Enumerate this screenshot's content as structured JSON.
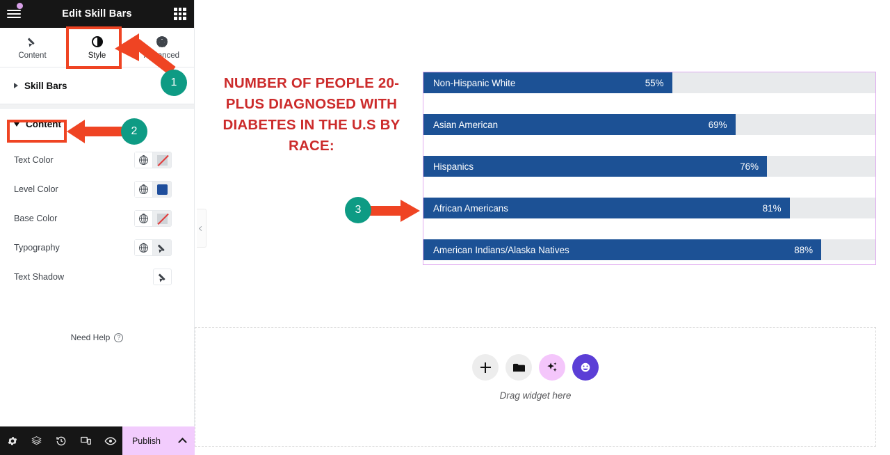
{
  "panel": {
    "title": "Edit Skill Bars",
    "menu_icon": "hamburger-icon",
    "apps_icon": "grid-icon",
    "tabs": [
      {
        "label": "Content",
        "icon": "pencil-icon",
        "active": false
      },
      {
        "label": "Style",
        "icon": "contrast-icon",
        "active": true
      },
      {
        "label": "Advanced",
        "icon": "gear-icon",
        "active": false
      }
    ],
    "sections": [
      {
        "label": "Skill Bars",
        "state": "collapsed"
      },
      {
        "label": "Content",
        "state": "expanded"
      }
    ],
    "controls": [
      {
        "label": "Text Color",
        "globe": "globe-icon",
        "value_type": "none",
        "value": ""
      },
      {
        "label": "Level Color",
        "globe": "globe-icon",
        "value_type": "color",
        "value": "#1f4e9c"
      },
      {
        "label": "Base Color",
        "globe": "globe-icon",
        "value_type": "none",
        "value": ""
      },
      {
        "label": "Typography",
        "globe": "globe-icon",
        "value_type": "edit",
        "value": ""
      },
      {
        "label": "Text Shadow",
        "globe": "",
        "value_type": "edit",
        "value": ""
      }
    ],
    "need_help": "Need Help",
    "bottom_icons": [
      "settings-icon",
      "layers-icon",
      "history-icon",
      "responsive-icon",
      "preview-icon"
    ],
    "publish_label": "Publish",
    "publish_caret": "chevron-up-icon"
  },
  "canvas": {
    "chart_title": "NUMBER OF PEOPLE 20-PLUS DIAGNOSED WITH DIABETES IN THE U.S BY RACE:",
    "collapse_icon": "chevron-left-icon",
    "drop_label": "Drag widget here",
    "drop_buttons": [
      "add-icon",
      "folder-icon",
      "ai-sparkle-icon",
      "elementor-icon"
    ]
  },
  "annotations": {
    "markers": [
      "1",
      "2",
      "3"
    ],
    "accent_circle": "#0e9b84",
    "accent_arrow": "#ef4423",
    "highlight_box": "#ef4423"
  },
  "chart_data": {
    "type": "bar",
    "title": "NUMBER OF PEOPLE 20-PLUS DIAGNOSED WITH DIABETES IN THE U.S BY RACE:",
    "orientation": "horizontal",
    "categories": [
      "Non-Hispanic White",
      "Asian American",
      "Hispanics",
      "African Americans",
      "American Indians/Alaska Natives"
    ],
    "values": [
      55,
      69,
      76,
      81,
      88
    ],
    "value_labels": [
      "55%",
      "69%",
      "76%",
      "81%",
      "88%"
    ],
    "xlim": [
      0,
      100
    ],
    "ylabel": "",
    "xlabel": "",
    "grid": false,
    "legend": "none",
    "bar_color": "#1c5195",
    "track_color": "#e8eaec",
    "label_color": "#ffffff"
  }
}
